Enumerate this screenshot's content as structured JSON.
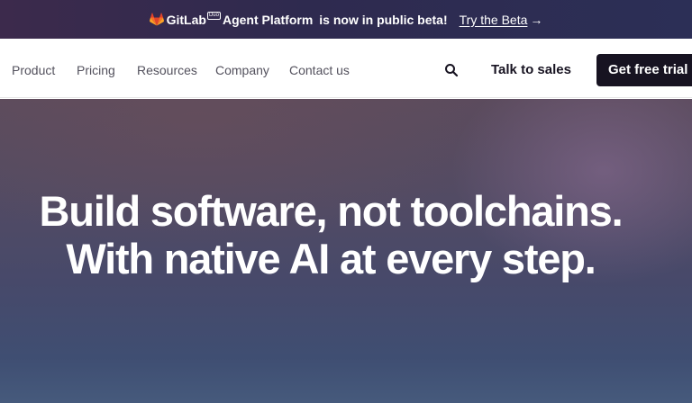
{
  "banner": {
    "brand": "GitLab",
    "badge": "Duo",
    "product": "Agent Platform",
    "message": "is now in public beta!",
    "link_label": "Try the Beta",
    "arrow": "→",
    "bg_colors": [
      "#3c2a4c",
      "#2c2f56"
    ],
    "logo_icon": "gitlab-tanuki-icon"
  },
  "nav": {
    "items": [
      {
        "label": "Product"
      },
      {
        "label": "Pricing"
      },
      {
        "label": "Resources"
      },
      {
        "label": "Company"
      },
      {
        "label": "Contact us"
      }
    ],
    "search_icon": "search-icon",
    "talk_to_sales": "Talk to sales",
    "cta": "Get free trial",
    "cta_color": "#171321"
  },
  "hero": {
    "line1": "Build software, not toolchains.",
    "line2": "With native AI at every step."
  }
}
